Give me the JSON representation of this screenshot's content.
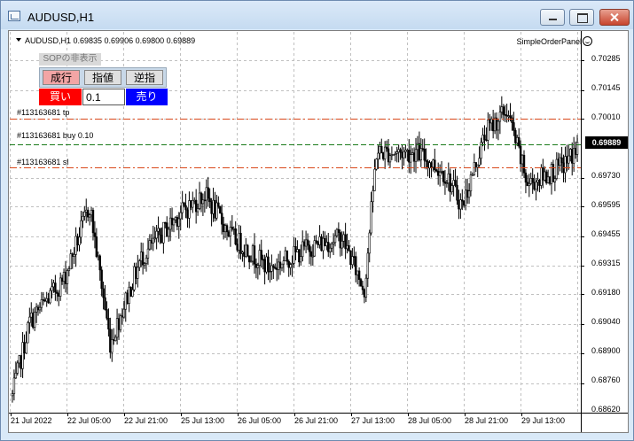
{
  "window": {
    "title": "AUDUSD,H1"
  },
  "chart": {
    "symbol_line": "AUDUSD,H1  0.69835 0.69906 0.69800 0.69889",
    "ea_name": "SimpleOrderPanel",
    "current_price": "0.69889",
    "price_labels": [
      "0.70285",
      "0.70145",
      "0.70010",
      "0.69730",
      "0.69595",
      "0.69455",
      "0.69315",
      "0.69180",
      "0.69040",
      "0.68900",
      "0.68760",
      "0.68620"
    ],
    "time_labels": [
      "21 Jul 2022",
      "22 Jul 05:00",
      "22 Jul 21:00",
      "25 Jul 13:00",
      "26 Jul 05:00",
      "26 Jul 21:00",
      "27 Jul 13:00",
      "28 Jul 05:00",
      "28 Jul 21:00",
      "29 Jul 13:00"
    ],
    "price_range": [
      0.6862,
      0.7042
    ],
    "order_lines": [
      {
        "label": "#113163681 tp",
        "price": 0.7001,
        "color": "#d9471a",
        "style": "dashdot"
      },
      {
        "label": "#113163681 buy 0.10",
        "price": 0.69889,
        "color": "#1a7a1a",
        "style": "dashed"
      },
      {
        "label": "#113163681 sl",
        "price": 0.6978,
        "color": "#d9471a",
        "style": "dashdot"
      }
    ],
    "colors": {
      "grid": "#c0c0c0",
      "candle": "#000000",
      "background": "#ffffff"
    }
  },
  "panel": {
    "toggle_label": "SOPの非表示",
    "order_types": [
      "成行",
      "指値",
      "逆指"
    ],
    "buy_label": "買い",
    "lot_value": "0.1",
    "sell_label": "売り",
    "colors": {
      "buy": "#ff0000",
      "sell": "#0000ff",
      "market_selected": "#f2a5a5"
    }
  }
}
